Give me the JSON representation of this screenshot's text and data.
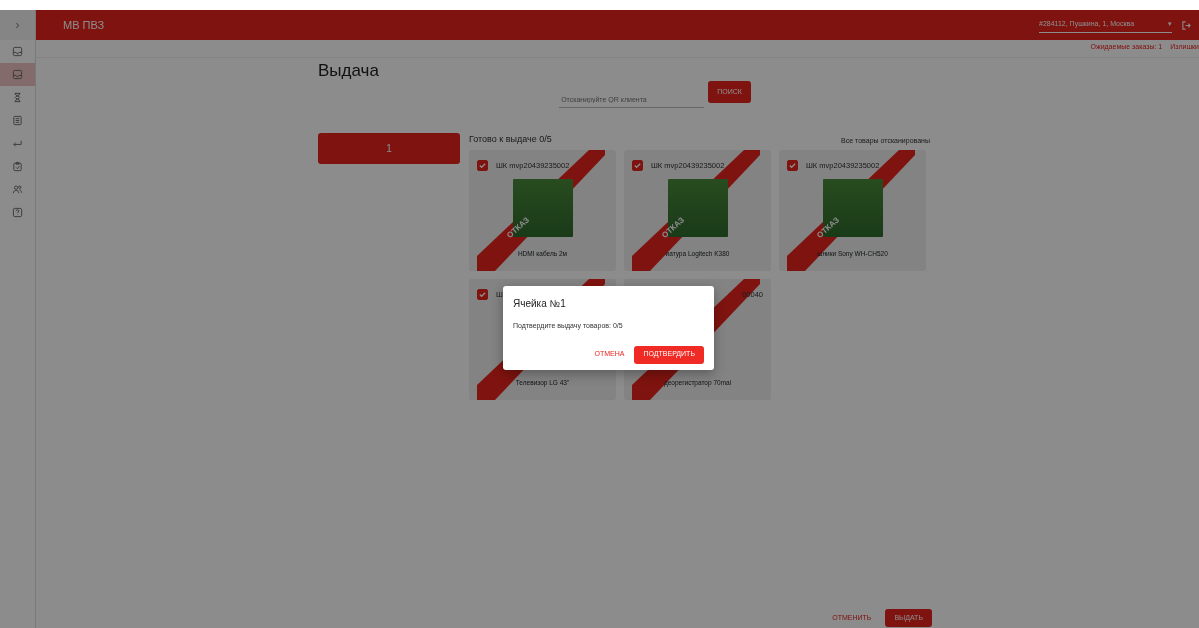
{
  "header": {
    "toggle": "›",
    "title": "МВ ПВЗ",
    "location": "#284112, Пушкина, 1, Москва",
    "caret": "▾"
  },
  "sidebar": {
    "items": [
      {
        "selected": false
      },
      {
        "selected": true
      },
      {
        "selected": false
      },
      {
        "selected": false
      },
      {
        "selected": false
      },
      {
        "selected": false
      },
      {
        "selected": false
      },
      {
        "selected": false
      }
    ]
  },
  "sublinks": [
    "Ожидаемые заказы: 1",
    "Излишки"
  ],
  "page_title": "Выдача",
  "search": {
    "placeholder": "Отсканируйте QR клиента",
    "button": "ПОИСК"
  },
  "cells": [
    {
      "label": "1",
      "selected": true
    }
  ],
  "ready_label": "Готово к выдаче 0/5",
  "scan_status": "Все товары отсканированы",
  "items": [
    {
      "barcode": "ШК mvp20439235002",
      "checked": true,
      "photo": true,
      "name": "HDMI кабель 2м",
      "refused": true,
      "ribbon": "ОТКАЗ"
    },
    {
      "barcode": "ШК mvp20439235002",
      "checked": true,
      "photo": true,
      "name": "иатура Logitech K380",
      "refused": true,
      "ribbon": "ОТКАЗ"
    },
    {
      "barcode": "ШК mvp20439235002",
      "checked": true,
      "photo": true,
      "name": "шники Sony WH-CH520",
      "refused": true,
      "ribbon": "ОТКАЗ"
    },
    {
      "barcode": "Ш",
      "checked": true,
      "photo": false,
      "name": "Телевизор LG 43\"",
      "refused": true
    },
    {
      "barcode": "00040",
      "photo": false,
      "name": "деорегистратор 70mai",
      "refused": true
    }
  ],
  "actions": {
    "cancel": "ОТМЕНИТЬ",
    "issue": "ВЫДАТЬ"
  },
  "dialog": {
    "title": "Ячейка №1",
    "message": "Подтвердите выдачу товаров: 0/5",
    "cancel": "ОТМЕНА",
    "confirm": "ПОДТВЕРДИТЬ"
  }
}
